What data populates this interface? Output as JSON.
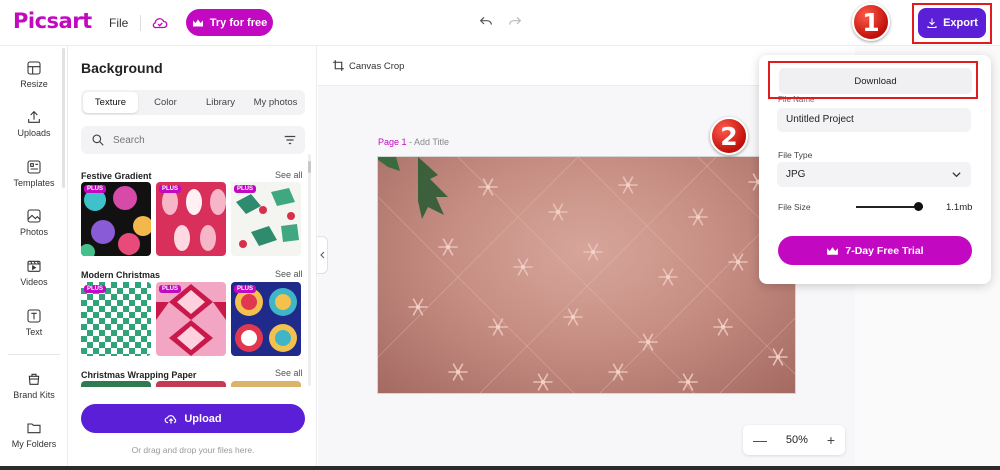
{
  "topbar": {
    "logo": "Picsart",
    "file_menu": "File",
    "try_button": "Try for free",
    "export_button": "Export"
  },
  "markers": {
    "one": "1",
    "two": "2"
  },
  "rail": {
    "items": [
      {
        "label": "Resize",
        "icon": "resize-icon"
      },
      {
        "label": "Uploads",
        "icon": "upload-icon"
      },
      {
        "label": "Templates",
        "icon": "templates-icon"
      },
      {
        "label": "Photos",
        "icon": "photos-icon"
      },
      {
        "label": "Videos",
        "icon": "videos-icon"
      },
      {
        "label": "Text",
        "icon": "text-icon"
      },
      {
        "label": "Brand Kits",
        "icon": "brand-kit-icon"
      },
      {
        "label": "My Folders",
        "icon": "folder-icon"
      }
    ]
  },
  "panel": {
    "title": "Background",
    "tabs": [
      "Texture",
      "Color",
      "Library",
      "My photos"
    ],
    "active_tab": "Texture",
    "search_placeholder": "Search",
    "sections": [
      {
        "title": "Festive Gradient",
        "see_all": "See all"
      },
      {
        "title": "Modern Christmas",
        "see_all": "See all"
      },
      {
        "title": "Christmas Wrapping Paper",
        "see_all": "See all"
      }
    ],
    "plus_badge": "PLUS",
    "upload_button": "Upload",
    "drag_hint": "Or drag and drop your files here."
  },
  "canvas": {
    "crop_label": "Canvas Crop",
    "page_number": "Page 1",
    "page_title_placeholder": " - Add Title",
    "zoom_level": "50%",
    "zoom_out": "—",
    "zoom_in": "+"
  },
  "export_popover": {
    "download_label": "Download",
    "file_name_label": "File Name",
    "file_name_value": "Untitled Project",
    "file_type_label": "File Type",
    "file_type_value": "JPG",
    "file_size_label": "File Size",
    "file_size_value": "1.1mb",
    "file_size_fraction": 0.93,
    "trial_button": "7-Day Free Trial"
  },
  "colors": {
    "brand_magenta": "#c209c1",
    "brand_purple": "#5a1fd6",
    "highlight_red": "#e21c1c"
  }
}
